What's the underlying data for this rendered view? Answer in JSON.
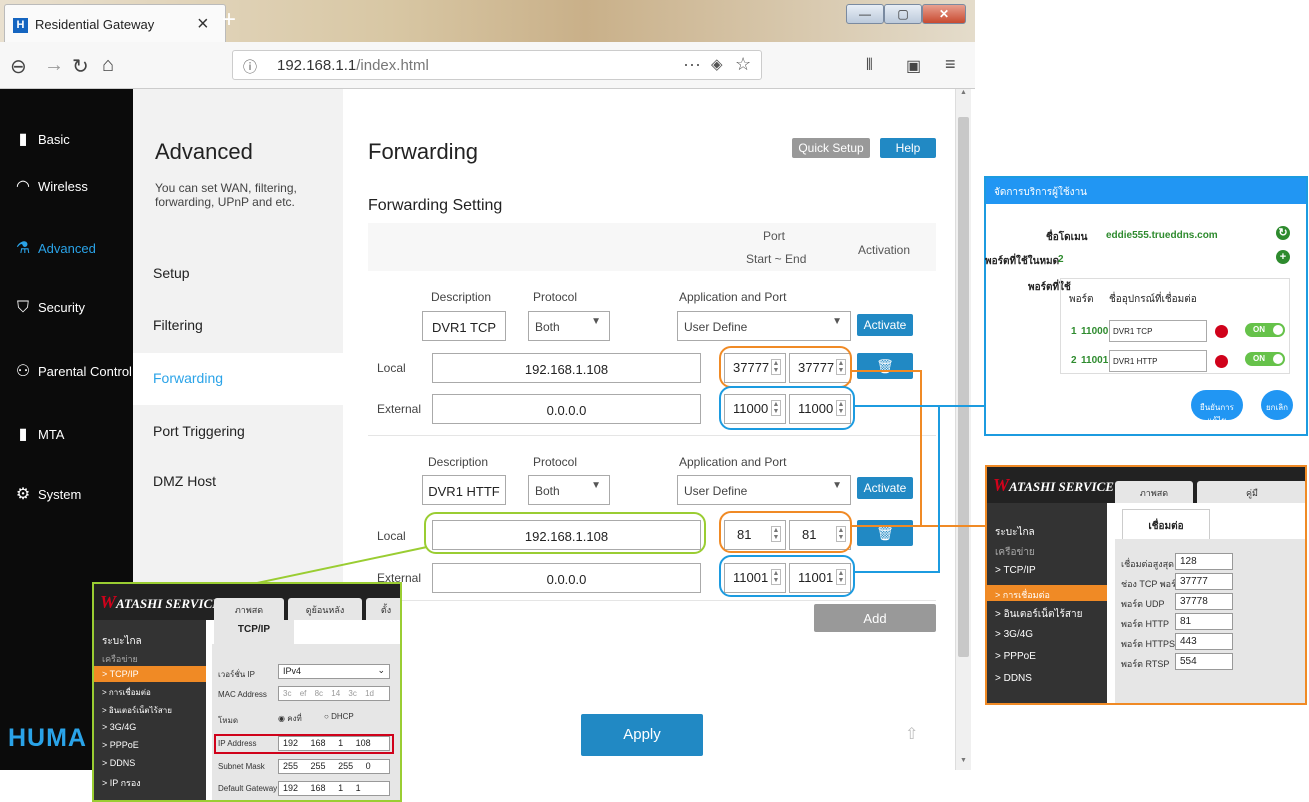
{
  "browser": {
    "tab_title": "Residential Gateway",
    "favicon": "H",
    "url_host": "192.168.1.1",
    "url_path": "/index.html",
    "plus": "+",
    "min": "—",
    "max": "▢",
    "close": "✕"
  },
  "sidebar": {
    "items": [
      {
        "label": "Basic",
        "icon": "bar-chart-icon"
      },
      {
        "label": "Wireless",
        "icon": "wifi-icon"
      },
      {
        "label": "Advanced",
        "icon": "flask-icon"
      },
      {
        "label": "Security",
        "icon": "shield-icon"
      },
      {
        "label": "Parental Control",
        "icon": "family-icon"
      },
      {
        "label": "MTA",
        "icon": "bar-chart-icon"
      },
      {
        "label": "System",
        "icon": "gear-icon"
      }
    ],
    "brand": "HUMA"
  },
  "submenu": {
    "title": "Advanced",
    "desc": "You can set WAN, filtering, forwarding, UPnP and etc.",
    "items": [
      "Setup",
      "Filtering",
      "Forwarding",
      "Port Triggering",
      "DMZ Host"
    ],
    "active": "Forwarding"
  },
  "main": {
    "title": "Forwarding",
    "quick_setup": "Quick Setup",
    "help": "Help",
    "section": "Forwarding Setting",
    "hdr_port": "Port",
    "hdr_range": "Start ~ End",
    "hdr_activation": "Activation",
    "col_desc": "Description",
    "col_proto": "Protocol",
    "col_app": "Application and Port",
    "local": "Local",
    "external": "External",
    "activate": "Activate",
    "add": "Add",
    "apply": "Apply",
    "rules": [
      {
        "desc": "DVR1 TCP",
        "proto": "Both",
        "app": "User Define",
        "local_ip": "192.168.1.108",
        "local_start": "37777",
        "local_end": "37777",
        "ext_ip": "0.0.0.0",
        "ext_start": "11000",
        "ext_end": "11000"
      },
      {
        "desc": "DVR1 HTTF",
        "proto": "Both",
        "app": "User Define",
        "local_ip": "192.168.1.108",
        "local_start": "81",
        "local_end": "81",
        "ext_ip": "0.0.0.0",
        "ext_start": "11001",
        "ext_end": "11001"
      }
    ]
  },
  "ddns_panel": {
    "header": "จัดการบริการผู้ใช้งาน",
    "domain_label": "ชื่อโดเมน",
    "domain": "eddie555.trueddns.com",
    "ports_label": "พอร์ตที่ใช้ในหมด",
    "ports": "2",
    "used_label": "พอร์ตที่ใช้",
    "col_port": "พอร์ต",
    "col_name": "ชื่ออุปกรณ์ที่เชื่อมต่อ",
    "rows": [
      {
        "n": "1",
        "port": "11000",
        "name": "DVR1 TCP",
        "state": "ON"
      },
      {
        "n": "2",
        "port": "11001",
        "name": "DVR1 HTTP",
        "state": "ON"
      }
    ],
    "btn_confirm": "ยืนยันการแก้ไข",
    "btn_cancel": "ยกเลิก"
  },
  "conn_panel": {
    "logo": "ATASHI SERVICE",
    "logo_w": "W",
    "tab1": "ภาพสด",
    "tab2": "คู่มื",
    "tab_title": "เชื่อมต่อ",
    "side": [
      "ระบะไกล",
      "เครือข่าย",
      "> TCP/IP",
      "> การเชื่อมต่อ",
      "> อินเตอร์เน็ตไร้สาย",
      "> 3G/4G",
      "> PPPoE",
      "> DDNS"
    ],
    "fields": [
      {
        "label": "เชื่อมต่อสูงสุด",
        "value": "128"
      },
      {
        "label": "ช่อง TCP พอร์ต",
        "value": "37777"
      },
      {
        "label": "พอร์ต UDP",
        "value": "37778"
      },
      {
        "label": "พอร์ต HTTP",
        "value": "81"
      },
      {
        "label": "พอร์ต HTTPS",
        "value": "443"
      },
      {
        "label": "พอร์ต RTSP",
        "value": "554"
      }
    ]
  },
  "tcp_panel": {
    "logo": "ATASHI SERVICE",
    "logo_w": "W",
    "tab1": "ภาพสด",
    "tab2": "ดูย้อนหลัง",
    "tab3": "ตั้ง",
    "tab_title": "TCP/IP",
    "side": [
      "ระบะไกล",
      "เครือข่าย",
      "> TCP/IP",
      "> การเชื่อมต่อ",
      "> อินเตอร์เน็ตไร้สาย",
      "> 3G/4G",
      "> PPPoE",
      "> DDNS",
      "> IP กรอง"
    ],
    "ver_label": "เวอร์ชั่น IP",
    "ver": "IPv4",
    "mac_label": "MAC Address",
    "mac": [
      "3c",
      "ef",
      "8c",
      "14",
      "3c",
      "1d"
    ],
    "mode_label": "โหมด",
    "mode_static": "คงที่",
    "mode_dhcp": "DHCP",
    "ip_label": "IP Address",
    "ip": [
      "192",
      "168",
      "1",
      "108"
    ],
    "mask_label": "Subnet Mask",
    "mask": [
      "255",
      "255",
      "255",
      "0"
    ],
    "gw_label": "Default Gateway",
    "gw": [
      "192",
      "168",
      "1",
      "1"
    ]
  }
}
